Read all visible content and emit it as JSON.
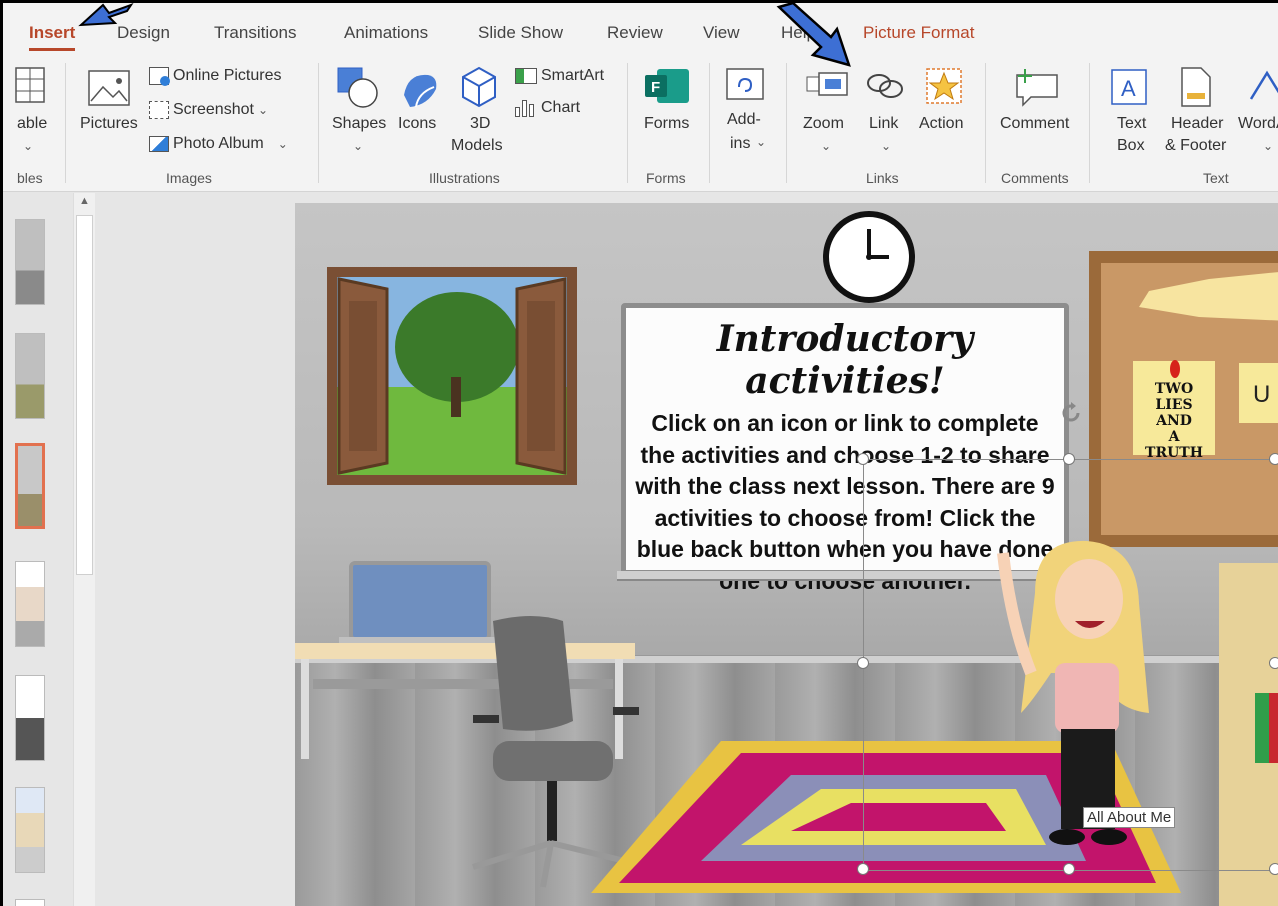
{
  "tabs": [
    "Insert",
    "Design",
    "Transitions",
    "Animations",
    "Slide Show",
    "Review",
    "View",
    "Help",
    "Picture Format"
  ],
  "ribbon": {
    "tables": {
      "label": "able",
      "group": "bles"
    },
    "images": {
      "pictures": "Pictures",
      "online_pictures": "Online Pictures",
      "screenshot": "Screenshot",
      "photo_album": "Photo Album",
      "group": "Images"
    },
    "illustrations": {
      "shapes": "Shapes",
      "icons": "Icons",
      "models_line1": "3D",
      "models_line2": "Models",
      "smartart": "SmartArt",
      "chart": "Chart",
      "group": "Illustrations"
    },
    "forms": {
      "label": "Forms",
      "group": "Forms"
    },
    "addins": {
      "line1": "Add-",
      "line2": "ins"
    },
    "links": {
      "zoom": "Zoom",
      "link": "Link",
      "action": "Action",
      "group": "Links"
    },
    "comments": {
      "comment": "Comment",
      "group": "Comments"
    },
    "text": {
      "textbox_line1": "Text",
      "textbox_line2": "Box",
      "header_line1": "Header",
      "header_line2": "& Footer",
      "wordart": "WordA",
      "group": "Text"
    }
  },
  "slide": {
    "title": "Introductory activities!",
    "body_lines": [
      "Click on an icon or link to complete",
      "the activities and choose 1-2 to share",
      "with the class next lesson. There are 9",
      "activities to choose from! Click the",
      "blue back button when you have done",
      "one to choose another."
    ],
    "note1_line1": "TWO",
    "note1_line2": "LIES AND",
    "note1_line3": "A TRUTH",
    "note2": "U",
    "tooltip": "All About Me"
  },
  "colors": {
    "accent": "#b7472a",
    "ribbon_bg": "#f3f3f3",
    "arrow_blue": "#2f5fc4"
  }
}
